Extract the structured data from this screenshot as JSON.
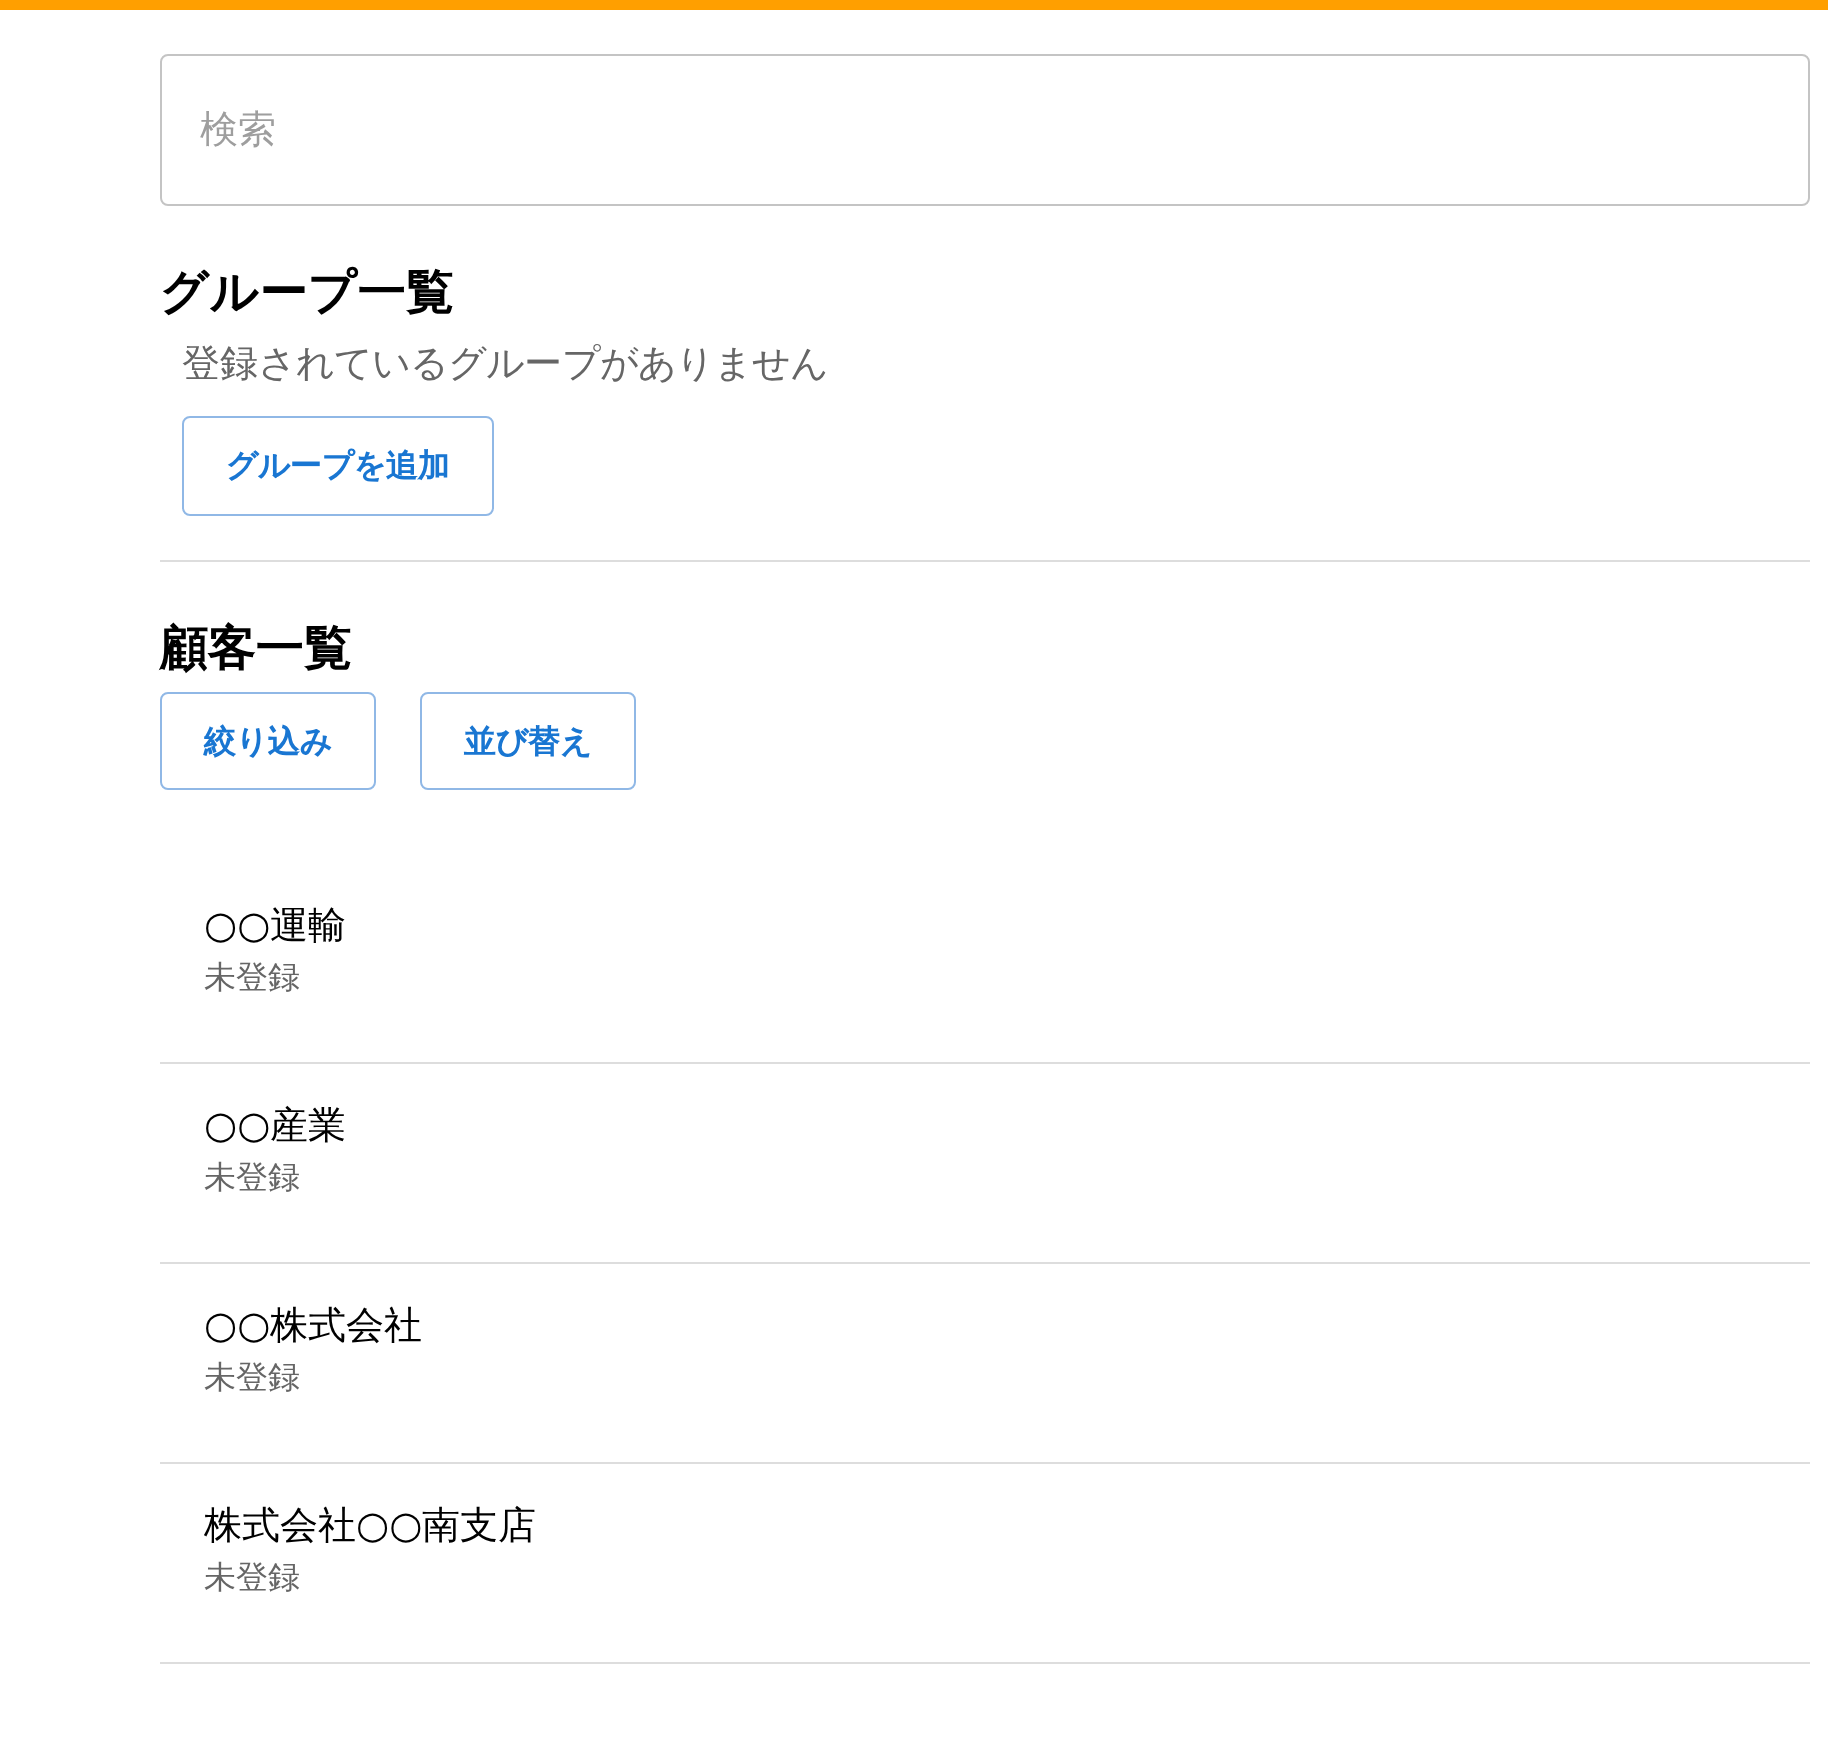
{
  "search": {
    "placeholder": "検索"
  },
  "groups": {
    "title": "グループ一覧",
    "empty_message": "登録されているグループがありません",
    "add_button": "グループを追加"
  },
  "customers": {
    "title": "顧客一覧",
    "buttons": [
      "絞り込み",
      "並び替え"
    ],
    "items": [
      {
        "name": "○○運輸",
        "status": "未登録"
      },
      {
        "name": "○○産業",
        "status": "未登録"
      },
      {
        "name": "○○株式会社",
        "status": "未登録"
      },
      {
        "name": "株式会社○○南支店",
        "status": "未登録"
      }
    ]
  }
}
